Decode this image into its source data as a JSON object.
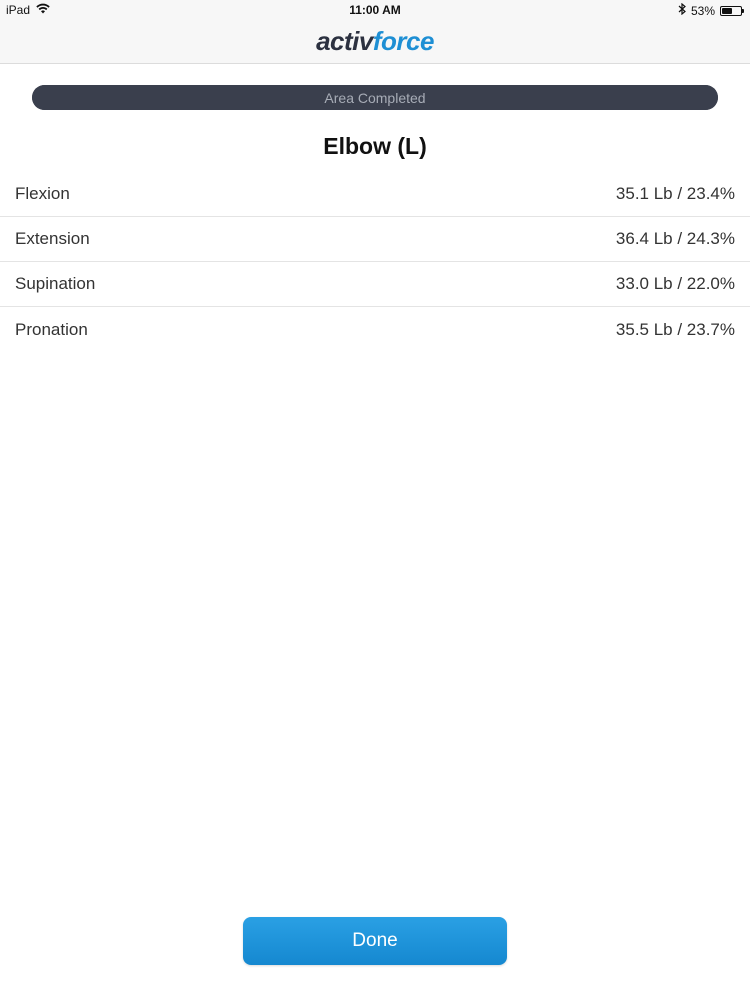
{
  "status_bar": {
    "device": "iPad",
    "time": "11:00 AM",
    "battery": "53%",
    "battery_level": 0.53,
    "icons": [
      "wifi-icon",
      "bluetooth-icon",
      "battery-icon"
    ]
  },
  "header": {
    "logo_part1": "activ",
    "logo_part2": "force"
  },
  "progress": {
    "label": "Area Completed",
    "value": 1.0
  },
  "area": {
    "title": "Elbow (L)"
  },
  "results": [
    {
      "label": "Flexion",
      "value": "35.1 Lb / 23.4%"
    },
    {
      "label": "Extension",
      "value": "36.4 Lb / 24.3%"
    },
    {
      "label": "Supination",
      "value": "33.0 Lb / 22.0%"
    },
    {
      "label": "Pronation",
      "value": "35.5 Lb / 23.7%"
    }
  ],
  "footer": {
    "done_label": "Done"
  },
  "colors": {
    "accent": "#1e8fd4",
    "logo_dark": "#2c3140",
    "progress_bar": "#3a3f4d"
  }
}
